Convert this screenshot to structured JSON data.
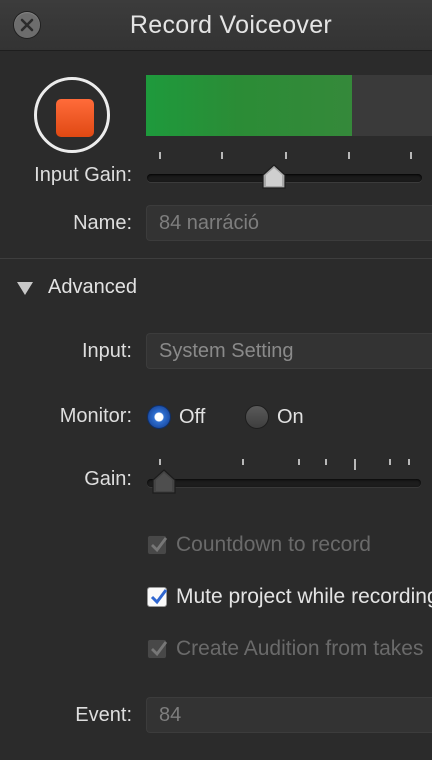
{
  "window": {
    "title": "Record Voiceover"
  },
  "record": {
    "input_gain_label": "Input Gain:",
    "meter_level": 0.71,
    "input_gain_level": 0.46
  },
  "name_field": {
    "label": "Name:",
    "value": "84 narráció"
  },
  "advanced": {
    "label": "Advanced",
    "input_label": "Input:",
    "input_value": "System Setting",
    "monitor_label": "Monitor:",
    "monitor_off": "Off",
    "monitor_on": "On",
    "monitor_selected": "Off",
    "gain_label": "Gain:",
    "gain_level": 0.02,
    "countdown_label": "Countdown to record",
    "mute_label": "Mute project while recording",
    "audition_label": "Create Audition from takes",
    "event_label": "Event:",
    "event_value": "84"
  },
  "colors": {
    "record": "#f0561f",
    "meter": "#2a9a3f",
    "radio_selected": "#2f6fd0",
    "checkbox_check": "#2f66d0"
  }
}
